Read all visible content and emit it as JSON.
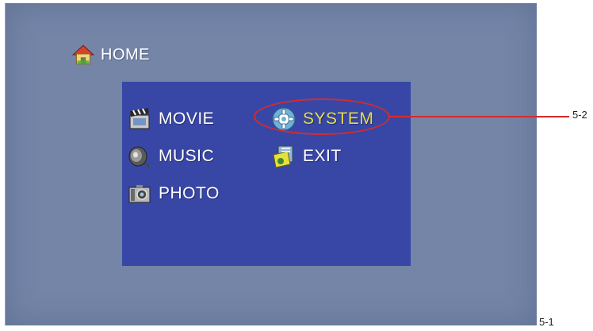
{
  "header": {
    "title": "HOME",
    "icon": "house-icon"
  },
  "menu": {
    "items": [
      {
        "label": "MOVIE",
        "icon": "film-clapper-icon",
        "selected": false
      },
      {
        "label": "SYSTEM",
        "icon": "gear-icon",
        "selected": true
      },
      {
        "label": "MUSIC",
        "icon": "speaker-icon",
        "selected": false
      },
      {
        "label": "EXIT",
        "icon": "exit-door-icon",
        "selected": false
      },
      {
        "label": "PHOTO",
        "icon": "camera-icon",
        "selected": false
      }
    ]
  },
  "callouts": {
    "selection": "5-2",
    "screen": "5-1"
  },
  "colors": {
    "screen_bg": "#7485a8",
    "panel_bg": "#3847a6",
    "selected_text": "#e7dc4a",
    "highlight_ring": "#d42c2c"
  }
}
